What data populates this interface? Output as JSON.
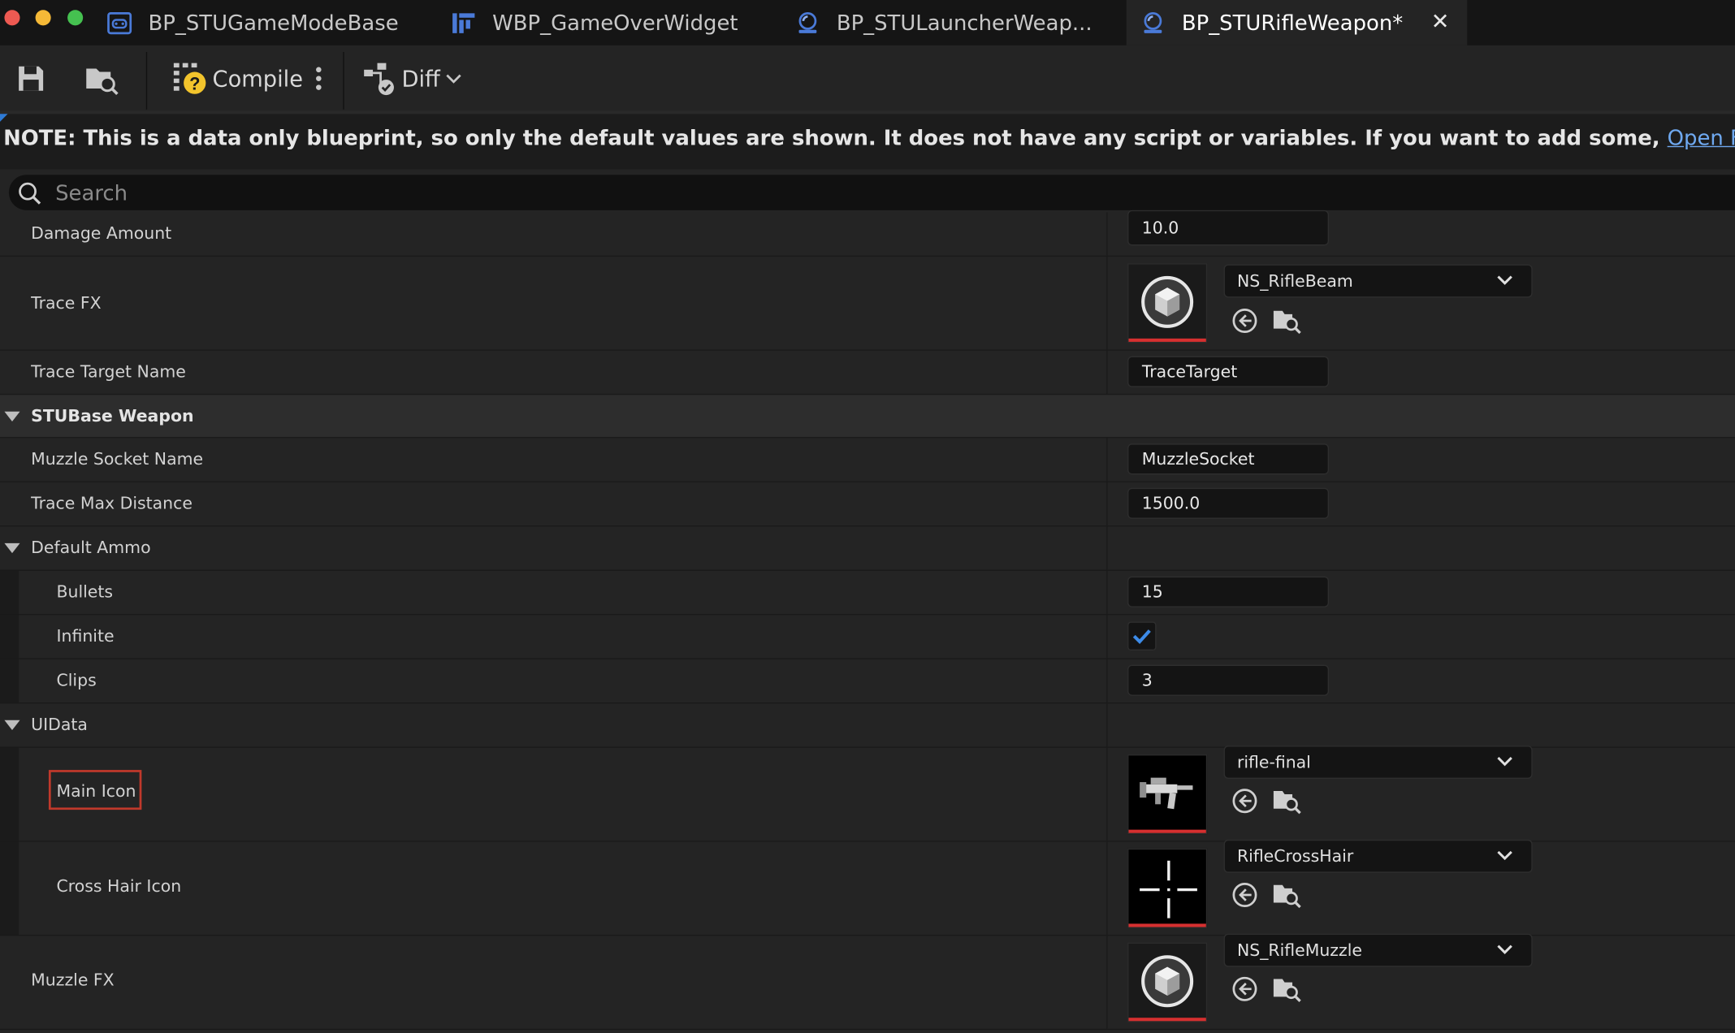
{
  "tabs": [
    {
      "label": "BP_STUGameModeBase",
      "icon": "game-mode-blueprint-icon"
    },
    {
      "label": "WBP_GameOverWidget",
      "icon": "widget-blueprint-icon"
    },
    {
      "label": "BP_STULauncherWeap...",
      "icon": "actor-blueprint-icon"
    },
    {
      "label": "BP_STURifleWeapon*",
      "icon": "actor-blueprint-icon"
    }
  ],
  "toolbar": {
    "compile_label": "Compile",
    "diff_label": "Diff"
  },
  "note": {
    "text": "NOTE: This is a data only blueprint, so only the default values are shown.  It does not have any script or variables.  If you want to add some,",
    "link": "Open Full Blueprint Editor"
  },
  "search": {
    "placeholder": "Search"
  },
  "properties": {
    "damage_amount": {
      "label": "Damage Amount",
      "value": "10.0"
    },
    "trace_fx": {
      "label": "Trace FX",
      "asset": "NS_RifleBeam"
    },
    "trace_target_name": {
      "label": "Trace Target Name",
      "value": "TraceTarget"
    },
    "stu_base_weapon": {
      "label": "STUBase Weapon"
    },
    "muzzle_socket_name": {
      "label": "Muzzle Socket Name",
      "value": "MuzzleSocket"
    },
    "trace_max_distance": {
      "label": "Trace Max Distance",
      "value": "1500.0"
    },
    "default_ammo": {
      "label": "Default Ammo"
    },
    "bullets": {
      "label": "Bullets",
      "value": "15"
    },
    "infinite": {
      "label": "Infinite",
      "checked": true
    },
    "clips": {
      "label": "Clips",
      "value": "3"
    },
    "ui_data": {
      "label": "UIData"
    },
    "main_icon": {
      "label": "Main Icon",
      "asset": "rifle-final"
    },
    "cross_hair_icon": {
      "label": "Cross Hair Icon",
      "asset": "RifleCrossHair"
    },
    "muzzle_fx": {
      "label": "Muzzle FX",
      "asset": "NS_RifleMuzzle"
    }
  },
  "colors": {
    "accent_blue": "#2e7bd6",
    "link": "#6fa9f0",
    "asset_red": "#d63030",
    "highlight_red": "#c0392b"
  }
}
